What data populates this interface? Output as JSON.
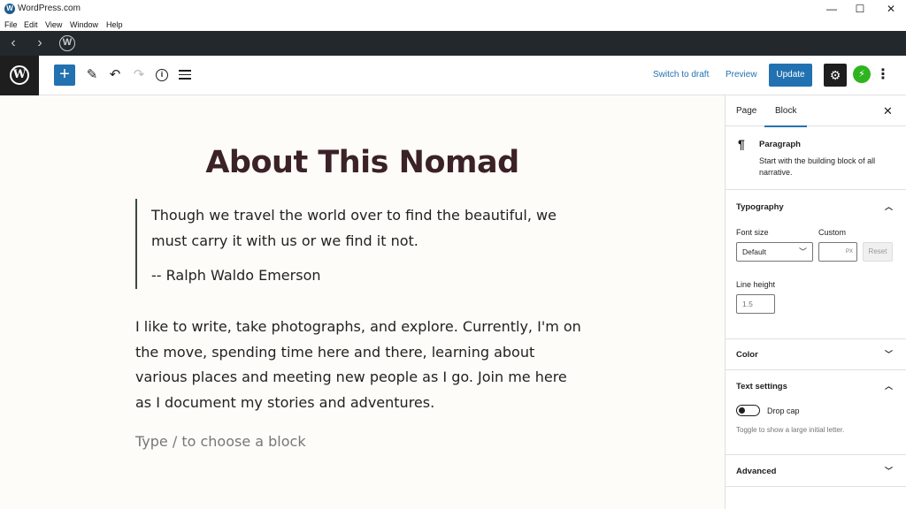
{
  "window": {
    "title": "WordPress.com",
    "controls": {
      "minimize": "—",
      "maximize": "☐",
      "close": "✕"
    }
  },
  "menubar": {
    "items": [
      "File",
      "Edit",
      "View",
      "Window",
      "Help"
    ]
  },
  "browser_nav": {
    "back": "‹",
    "forward": "›",
    "logo": "W"
  },
  "header": {
    "logo": "W",
    "inserter": "+",
    "tools": {
      "edit": "✎",
      "undo": "↶",
      "redo": "↷",
      "info": "i"
    },
    "switch_to_draft": "Switch to draft",
    "preview": "Preview",
    "update": "Update",
    "settings": "⚙",
    "jetpack": "⚡",
    "more": "⋮"
  },
  "content": {
    "title": "About This Nomad",
    "quote": {
      "text": "Though we travel the world over to find the beautiful, we must carry it with us or we find it not.",
      "citation": "-- Ralph Waldo Emerson"
    },
    "paragraph": "I like to write, take photographs, and explore. Currently, I'm on the move, spending time here and there, learning about various places and meeting new people as I go. Join me here as I document my stories and adventures.",
    "placeholder": "Type / to choose a block"
  },
  "sidebar": {
    "tabs": [
      "Page",
      "Block"
    ],
    "active_tab": "Block",
    "close": "✕",
    "block": {
      "icon": "¶",
      "name": "Paragraph",
      "description": "Start with the building block of all narrative."
    },
    "typography": {
      "title": "Typography",
      "font_size_label": "Font size",
      "font_size_value": "Default",
      "custom_label": "Custom",
      "custom_unit": "PX",
      "reset": "Reset",
      "line_height_label": "Line height",
      "line_height_placeholder": "1.5"
    },
    "color": {
      "title": "Color"
    },
    "text_settings": {
      "title": "Text settings",
      "drop_cap_label": "Drop cap",
      "drop_cap_help": "Toggle to show a large initial letter."
    },
    "advanced": {
      "title": "Advanced"
    }
  }
}
